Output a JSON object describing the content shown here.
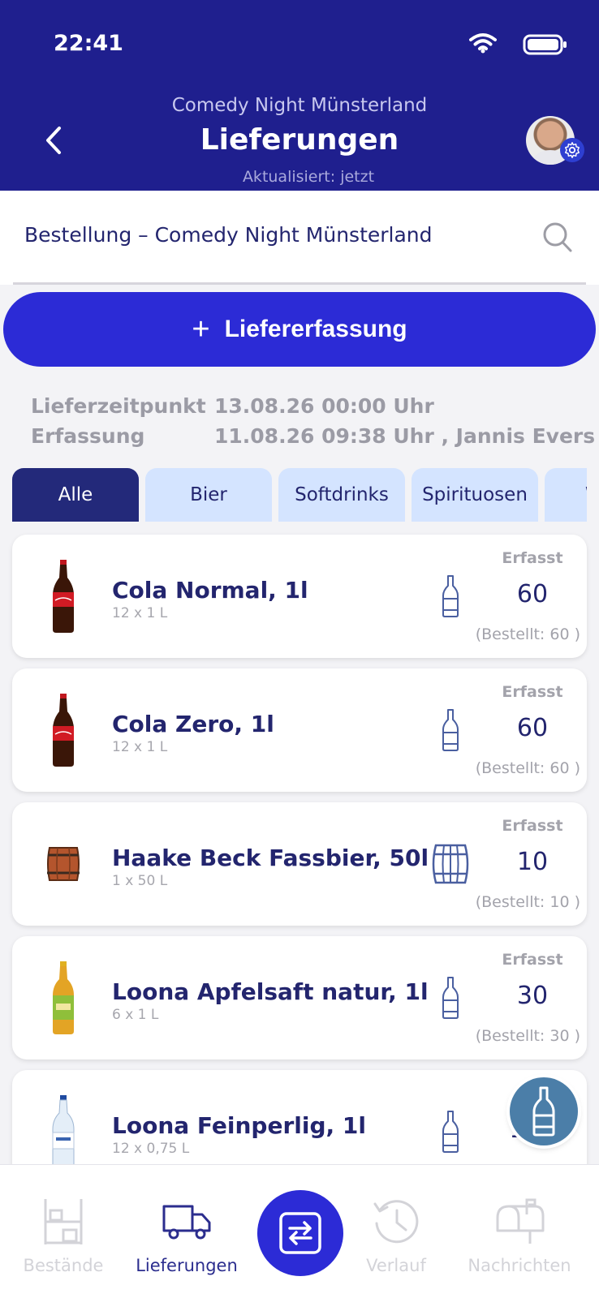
{
  "status_bar": {
    "time": "22:41"
  },
  "header": {
    "organization": "Comedy Night Münsterland",
    "title": "Lieferungen",
    "updated": "Aktualisiert: jetzt"
  },
  "search": {
    "value": "Bestellung – Comedy Night Münsterland"
  },
  "add_button": {
    "plus": "+",
    "label": "Liefererfassung"
  },
  "info": {
    "delivery_time_label": "Lieferzeitpunkt",
    "delivery_time_value": "13.08.26 00:00 Uhr",
    "capture_label": "Erfassung",
    "capture_value": "11.08.26 09:38 Uhr , Jannis Evers"
  },
  "tabs": [
    "Alle",
    "Bier",
    "Softdrinks",
    "Spirituosen",
    "W"
  ],
  "products": [
    {
      "name": "Cola Normal, 1l",
      "pack": "12 x 1 L",
      "erfasst_label": "Erfasst",
      "erfasst": "60",
      "ordered": "(Bestellt: 60 )",
      "image": "cola-bottle",
      "unit_icon": "bottle-icon"
    },
    {
      "name": "Cola Zero, 1l",
      "pack": "12 x 1 L",
      "erfasst_label": "Erfasst",
      "erfasst": "60",
      "ordered": "(Bestellt: 60 )",
      "image": "cola-bottle",
      "unit_icon": "bottle-icon"
    },
    {
      "name": "Haake Beck Fassbier, 50l",
      "pack": "1 x 50 L",
      "erfasst_label": "Erfasst",
      "erfasst": "10",
      "ordered": "(Bestellt: 10 )",
      "image": "barrel",
      "unit_icon": "barrel-icon"
    },
    {
      "name": "Loona Apfelsaft natur, 1l",
      "pack": "6 x 1 L",
      "erfasst_label": "Erfasst",
      "erfasst": "30",
      "ordered": "(Bestellt: 30 )",
      "image": "juice-bottle",
      "unit_icon": "bottle-icon"
    },
    {
      "name": "Loona Feinperlig, 1l",
      "pack": "12 x 0,75 L",
      "erfasst_label": "E",
      "erfasst": "120",
      "ordered": "",
      "image": "water-bottle",
      "unit_icon": "bottle-icon"
    }
  ],
  "nav": {
    "bestaende": "Bestände",
    "lieferungen": "Lieferungen",
    "verlauf": "Verlauf",
    "nachrichten": "Nachrichten"
  },
  "colors": {
    "header": "#1f1f8e",
    "accent": "#2c2bd6",
    "navy_text": "#23256e",
    "tab_active": "#23297a",
    "tab_inactive": "#d4e4ff",
    "fab": "#4b7ea8"
  }
}
